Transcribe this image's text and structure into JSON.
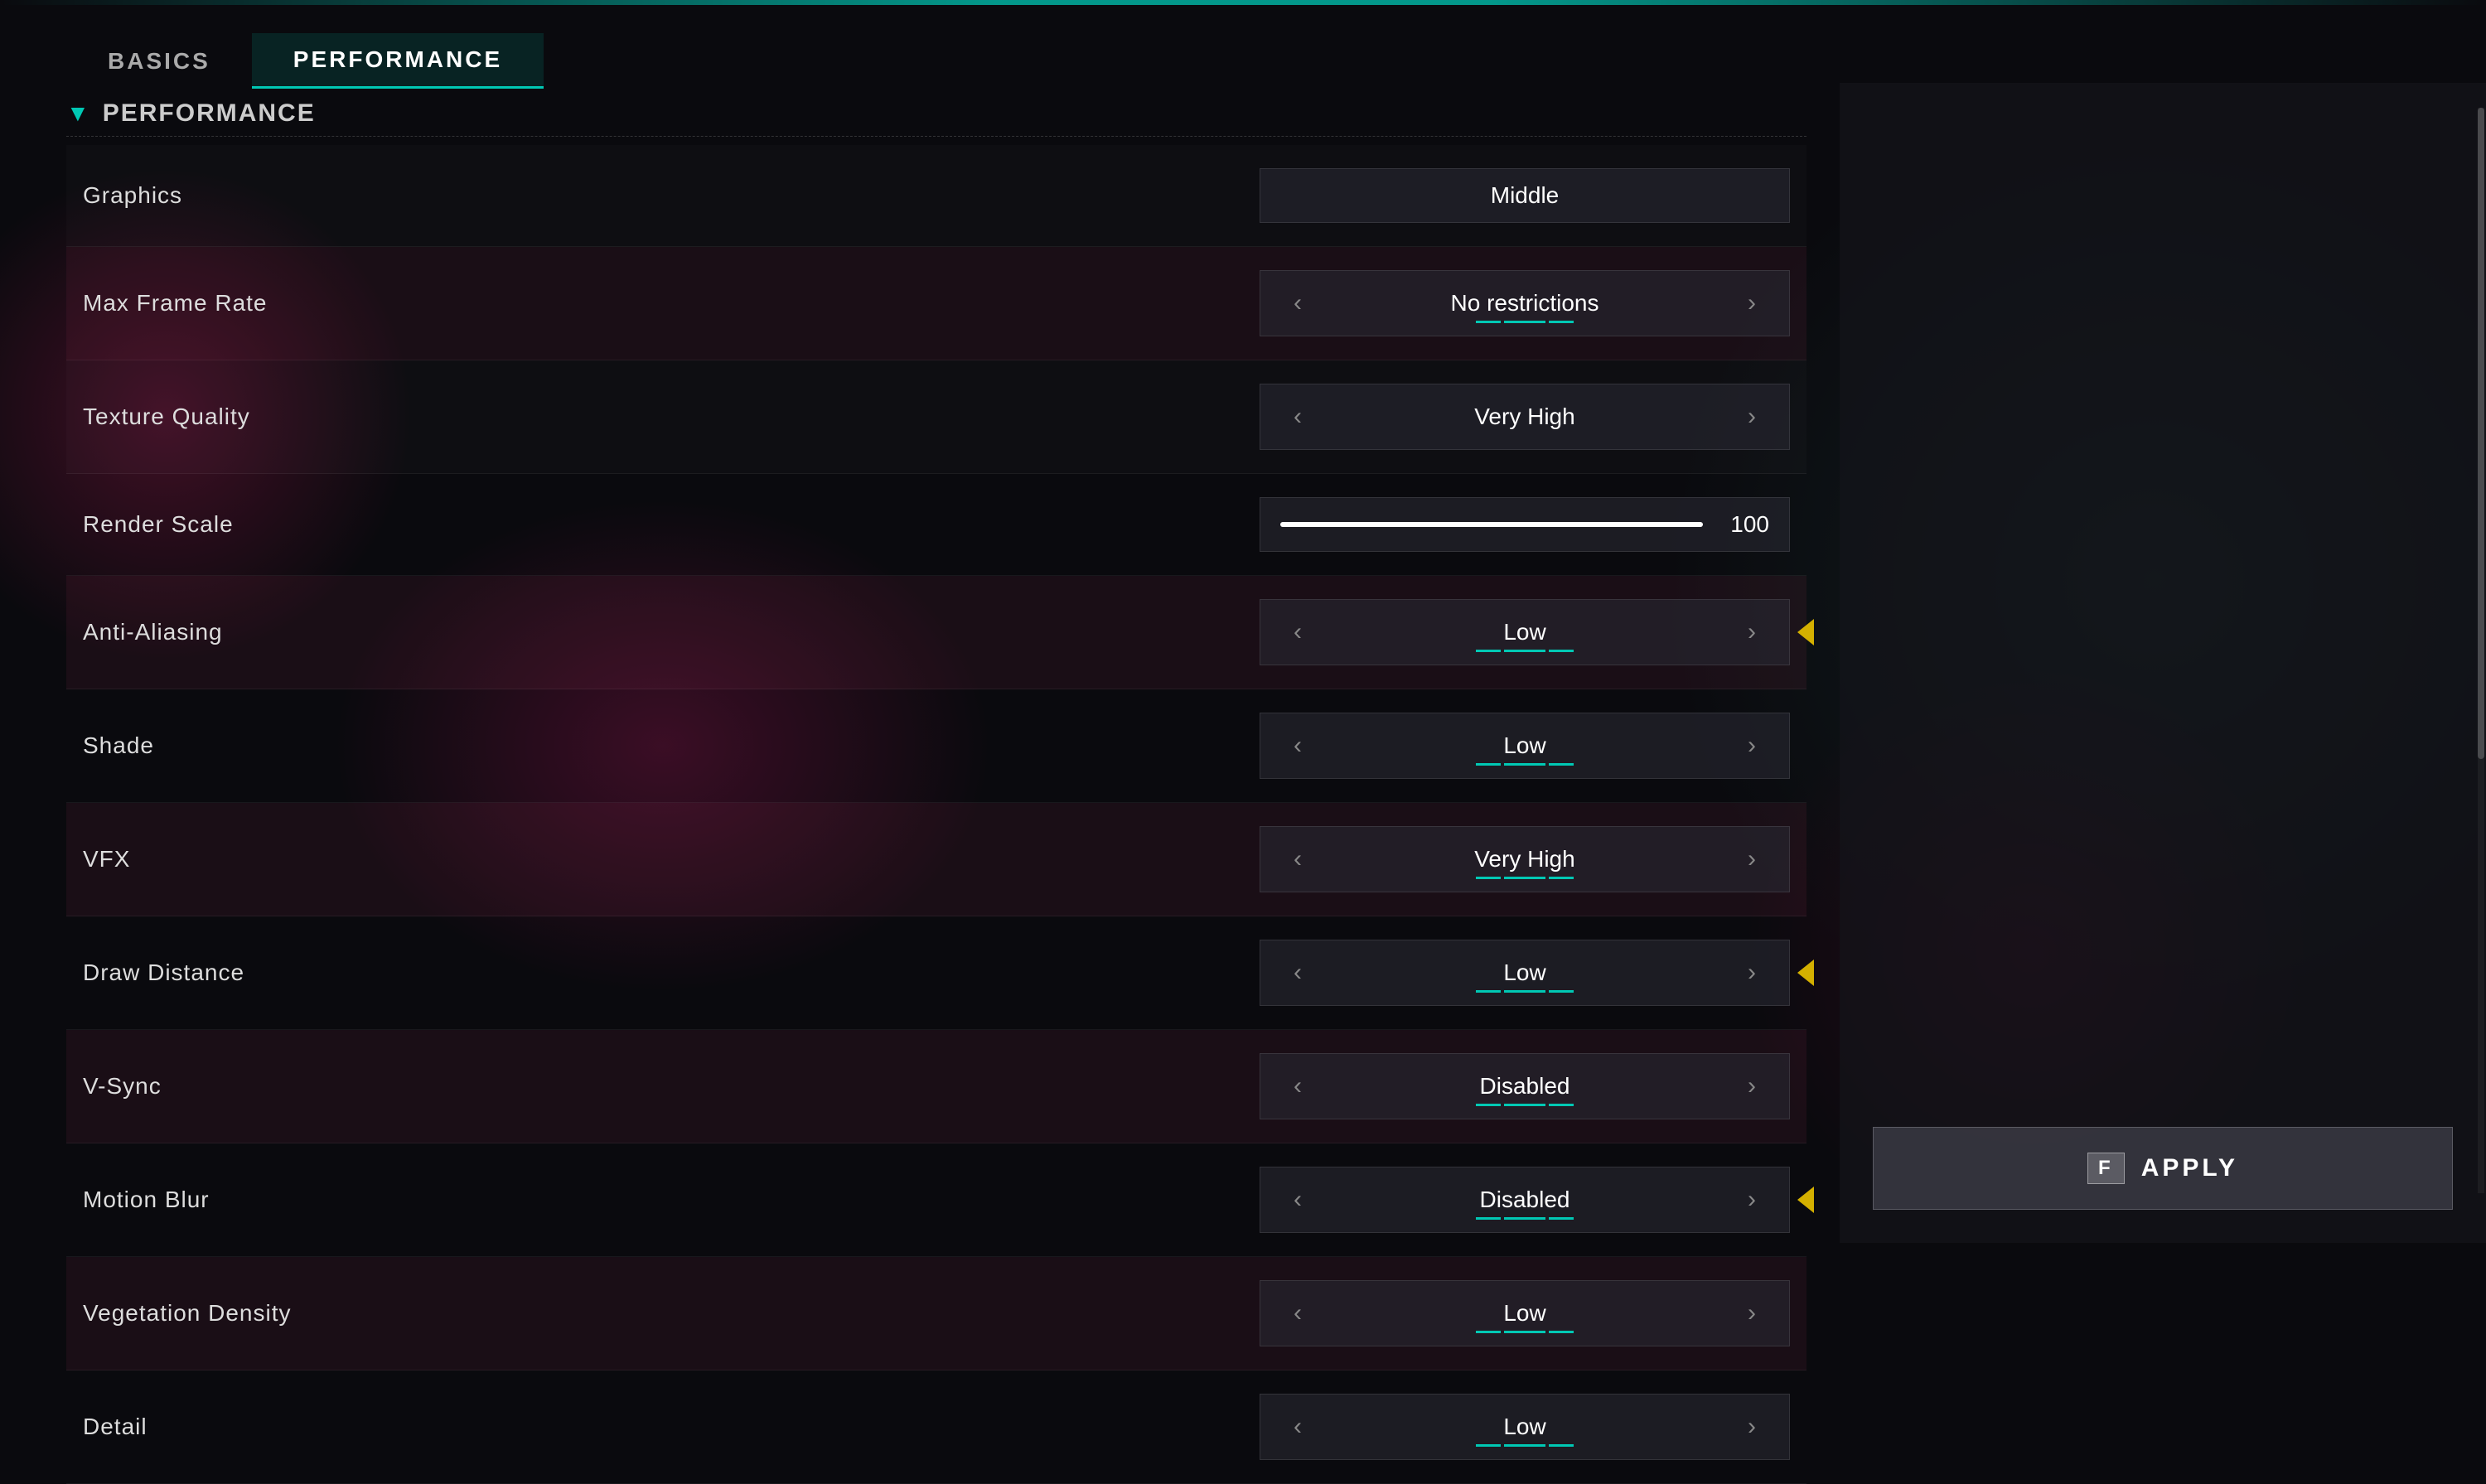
{
  "topAccent": true,
  "tabs": [
    {
      "id": "basics",
      "label": "BASICS",
      "active": false
    },
    {
      "id": "performance",
      "label": "PERFORMANCE",
      "active": true
    }
  ],
  "section": {
    "title": "Performance",
    "expandIcon": "▼"
  },
  "settings": [
    {
      "id": "graphics",
      "label": "Graphics",
      "valueType": "select",
      "value": "Middle",
      "hasArrows": false,
      "highlighted": false,
      "yellowIndicator": false,
      "underline": false
    },
    {
      "id": "max-frame-rate",
      "label": "Max Frame Rate",
      "valueType": "select",
      "value": "No restrictions",
      "hasArrows": true,
      "highlighted": true,
      "yellowIndicator": false,
      "underline": true
    },
    {
      "id": "texture-quality",
      "label": "Texture Quality",
      "valueType": "select",
      "value": "Very High",
      "hasArrows": true,
      "highlighted": false,
      "yellowIndicator": false,
      "underline": false
    },
    {
      "id": "render-scale",
      "label": "Render Scale",
      "valueType": "slider",
      "value": 100,
      "sliderPercent": 100,
      "hasArrows": false,
      "highlighted": false,
      "yellowIndicator": false,
      "underline": false
    },
    {
      "id": "anti-aliasing",
      "label": "Anti-Aliasing",
      "valueType": "select",
      "value": "Low",
      "hasArrows": true,
      "highlighted": true,
      "yellowIndicator": true,
      "underline": true
    },
    {
      "id": "shade",
      "label": "Shade",
      "valueType": "select",
      "value": "Low",
      "hasArrows": true,
      "highlighted": false,
      "yellowIndicator": false,
      "underline": true
    },
    {
      "id": "vfx",
      "label": "VFX",
      "valueType": "select",
      "value": "Very High",
      "hasArrows": true,
      "highlighted": true,
      "yellowIndicator": false,
      "underline": true
    },
    {
      "id": "draw-distance",
      "label": "Draw Distance",
      "valueType": "select",
      "value": "Low",
      "hasArrows": true,
      "highlighted": false,
      "yellowIndicator": true,
      "underline": true
    },
    {
      "id": "v-sync",
      "label": "V-Sync",
      "valueType": "select",
      "value": "Disabled",
      "hasArrows": true,
      "highlighted": true,
      "yellowIndicator": false,
      "underline": true
    },
    {
      "id": "motion-blur",
      "label": "Motion Blur",
      "valueType": "select",
      "value": "Disabled",
      "hasArrows": true,
      "highlighted": false,
      "yellowIndicator": true,
      "underline": true
    },
    {
      "id": "vegetation-density",
      "label": "Vegetation Density",
      "valueType": "select",
      "value": "Low",
      "hasArrows": true,
      "highlighted": true,
      "yellowIndicator": false,
      "underline": true
    },
    {
      "id": "detail",
      "label": "Detail",
      "valueType": "select",
      "value": "Low",
      "hasArrows": true,
      "highlighted": false,
      "yellowIndicator": false,
      "underline": true
    }
  ],
  "applyButton": {
    "keyLabel": "F",
    "label": "APPLY"
  },
  "arrows": {
    "left": "‹",
    "right": "›"
  }
}
